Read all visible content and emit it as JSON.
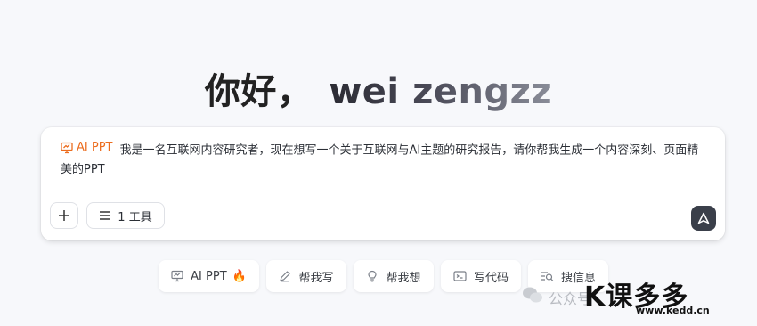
{
  "greeting": {
    "hello": "你好，",
    "name": "wei zengzz"
  },
  "composer": {
    "tag_label": "AI PPT",
    "prompt_text": "我是一名互联网内容研究者，现在想写一个关于互联网与AI主题的研究报告，请你帮我生成一个内容深刻、页面精美的PPT",
    "tools_label": "1 工具",
    "accent_color": "#ec6d1f"
  },
  "chips": [
    {
      "label": "AI PPT",
      "icon": "presentation-icon",
      "badge": "🔥"
    },
    {
      "label": "帮我写",
      "icon": "pen-icon"
    },
    {
      "label": "帮我想",
      "icon": "lightbulb-icon"
    },
    {
      "label": "写代码",
      "icon": "terminal-icon"
    },
    {
      "label": "搜信息",
      "icon": "search-list-icon"
    }
  ],
  "watermark": {
    "wechat_text": "公众号",
    "brand": "K课多多",
    "url": "www.kedd.cn"
  }
}
